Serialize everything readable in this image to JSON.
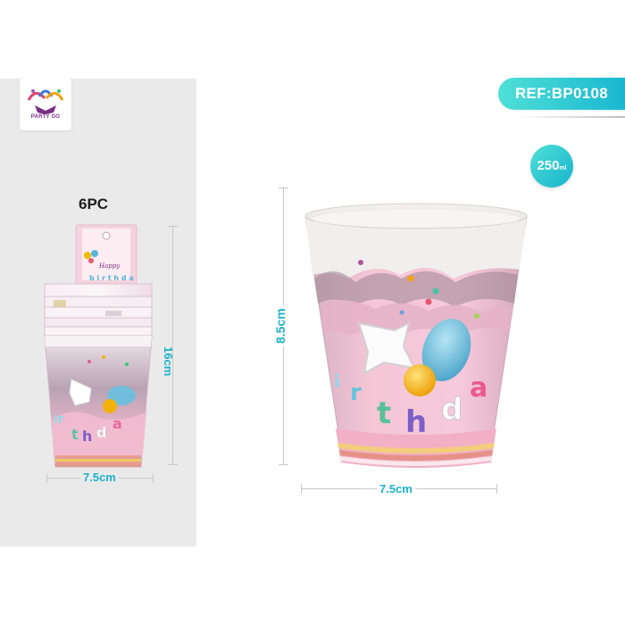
{
  "brand": {
    "logo_text": "PARTY GO"
  },
  "ref": {
    "label": "REF:BP0108"
  },
  "volume": {
    "value": "250",
    "unit": "ml"
  },
  "pack": {
    "count_label": "6PC",
    "header_card_text": "Happy"
  },
  "dimensions": {
    "pack_height": "16cm",
    "pack_width": "7.5cm",
    "cup_height": "8.5cm",
    "cup_width": "7.5cm"
  },
  "cup_print": {
    "letters": [
      "i",
      "r",
      "t",
      "h",
      "d",
      "a"
    ]
  },
  "colors": {
    "accent": "#1bb4cc",
    "badge_gradient_start": "#4fe0d6",
    "cup_pink": "#f0b3c6",
    "panel_bg": "#eaeaea"
  }
}
